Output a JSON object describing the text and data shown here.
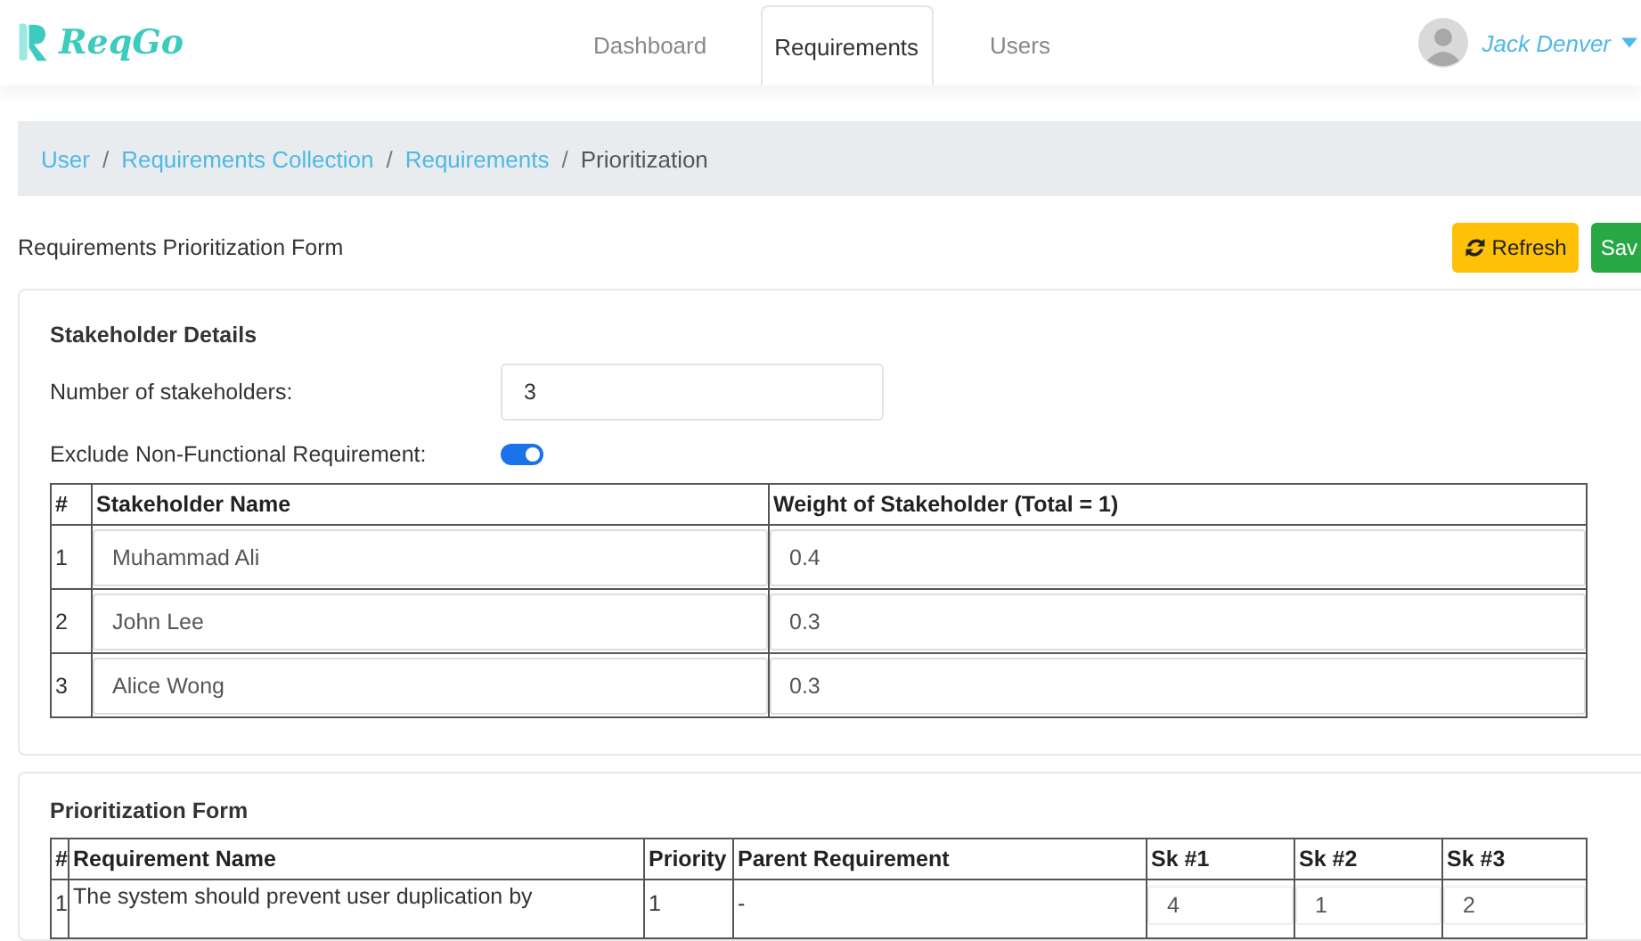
{
  "brand": "ReqGo",
  "nav_tabs": [
    {
      "label": "Dashboard",
      "selected": false
    },
    {
      "label": "Requirements",
      "selected": true
    },
    {
      "label": "Users",
      "selected": false
    }
  ],
  "user": {
    "name": "Jack Denver"
  },
  "breadcrumb": [
    {
      "kind": "link",
      "text": "User"
    },
    {
      "kind": "separator",
      "text": "/"
    },
    {
      "kind": "link",
      "text": "Requirements Collection"
    },
    {
      "kind": "separator",
      "text": "/"
    },
    {
      "kind": "link",
      "text": "Requirements"
    },
    {
      "kind": "separator",
      "text": "/"
    },
    {
      "kind": "current",
      "text": "Prioritization"
    }
  ],
  "page_title": "Requirements Prioritization Form",
  "actions": [
    {
      "label": "Refresh",
      "kind": "refresh"
    },
    {
      "label": "Sav",
      "kind": "save"
    }
  ],
  "stakeholder_details": {
    "heading": "Stakeholder Details",
    "count_label": "Number of stakeholders:",
    "count_value": "3",
    "exclude_label": "Exclude Non-Functional Requirement:",
    "exclude_on": true,
    "columns": [
      "#",
      "Stakeholder Name",
      "Weight of Stakeholder (Total = 1)"
    ],
    "rows": [
      {
        "index": "1",
        "name": "Muhammad Ali",
        "weight": "0.4"
      },
      {
        "index": "2",
        "name": "John Lee",
        "weight": "0.3"
      },
      {
        "index": "3",
        "name": "Alice Wong",
        "weight": "0.3"
      }
    ]
  },
  "prioritization": {
    "heading": "Prioritization Form",
    "columns": [
      "#",
      "Requirement Name",
      "Priority",
      "Parent Requirement",
      "Sk #1",
      "Sk #2",
      "Sk #3"
    ],
    "rows": [
      {
        "index": "1",
        "name": "The system should prevent user duplication by",
        "priority": "1",
        "parent": "-",
        "scores": [
          "4",
          "1",
          "2"
        ]
      }
    ]
  }
}
